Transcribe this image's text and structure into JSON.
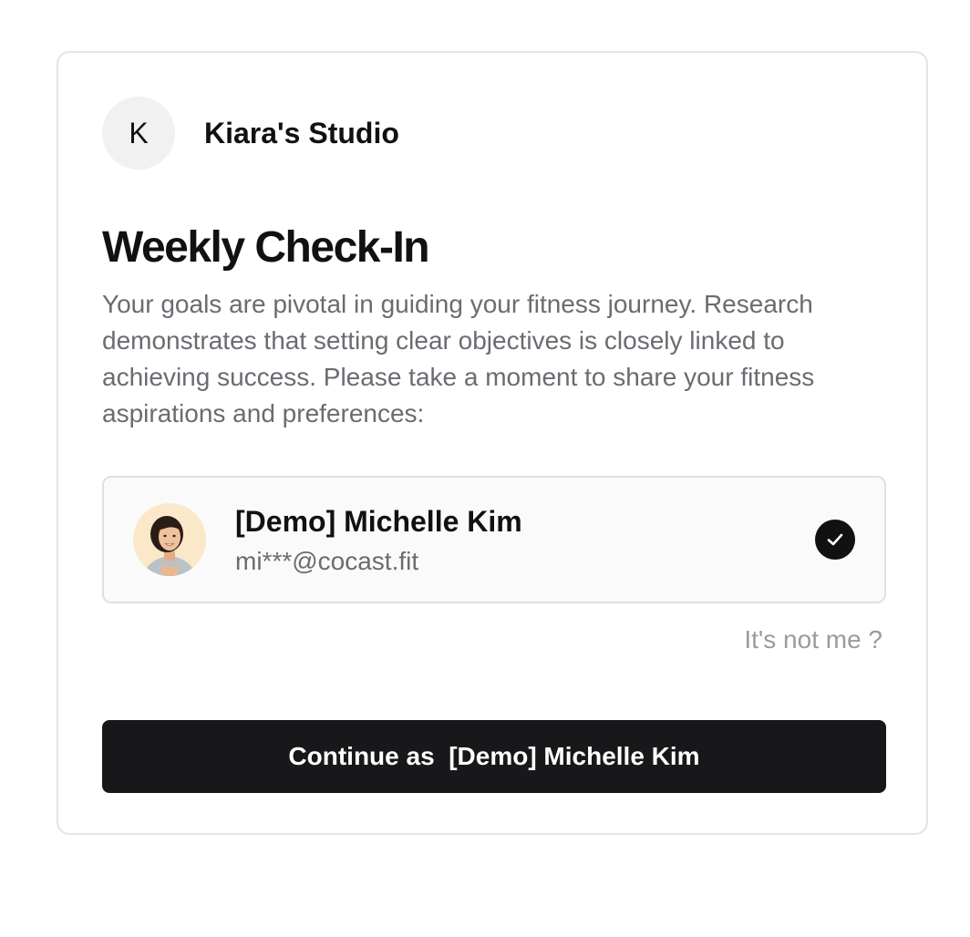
{
  "studio": {
    "initial": "K",
    "name": "Kiara's Studio"
  },
  "checkin": {
    "title": "Weekly Check-In",
    "description": "Your goals are pivotal in guiding your fitness journey. Research demonstrates that setting clear objectives is closely linked to achieving success. Please take a moment to share your fitness aspirations and preferences:"
  },
  "account": {
    "name": "[Demo] Michelle Kim",
    "email": "mi***@cocast.fit",
    "avatar_icon": "user-photo",
    "selected": true
  },
  "actions": {
    "not_me_label": "It's not me ?",
    "continue_prefix": "Continue as",
    "continue_name": "[Demo] Michelle Kim"
  },
  "colors": {
    "button_bg": "#18181b",
    "check_bg": "#111111",
    "muted_text": "#6b6b72"
  }
}
